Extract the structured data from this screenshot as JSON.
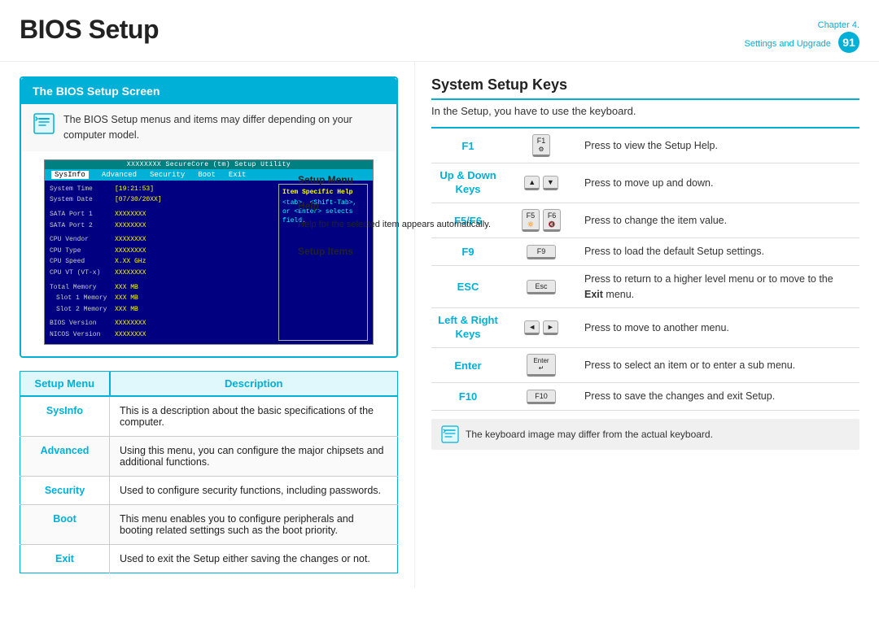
{
  "header": {
    "title": "BIOS Setup",
    "chapter": "Chapter 4.",
    "chapter_sub": "Settings and Upgrade",
    "page_num": "91"
  },
  "left": {
    "section_title": "The BIOS Setup Screen",
    "note_text": "The BIOS Setup menus and items may differ depending on your computer model.",
    "bios_mock": {
      "title_bar": "XXXXXXXX SecureCore (tm) Setup Utility",
      "menu_items": [
        "SysInfo",
        "Advanced",
        "Security",
        "Boot",
        "Exit"
      ],
      "active_menu": "SysInfo",
      "help_title": "Item Specific Help",
      "help_text": "<tab>, <Shift-Tab>, or <Enter> selects field.",
      "items": [
        {
          "label": "System Time",
          "value": "[19:21:53]"
        },
        {
          "label": "System Date",
          "value": "[07/30/20XX]"
        },
        {
          "label": "SATA Port 1",
          "value": "XXXXXXXX"
        },
        {
          "label": "SATA Port 2",
          "value": "XXXXXXXX"
        },
        {
          "label": "CPU Vendor",
          "value": "XXXXXXXX"
        },
        {
          "label": "CPU Type",
          "value": "XXXXXXXX"
        },
        {
          "label": "CPU Speed",
          "value": "X.XX GHz"
        },
        {
          "label": "CPU VT (VT-x)",
          "value": "XXXXXXXX"
        },
        {
          "label": "Total Memory",
          "value": "XXX MB"
        },
        {
          "label": "  Slot 1 Memory",
          "value": "XXX MB"
        },
        {
          "label": "  Slot 2 Memory",
          "value": "XXX MB"
        },
        {
          "label": "BIOS Version",
          "value": "XXXXXXXX"
        },
        {
          "label": "NICOS Version",
          "value": "XXXXXXXX"
        }
      ]
    },
    "labels": {
      "setup_menu": "Setup Menu",
      "help": "Help",
      "help_desc": "Help for the selected item appears automatically.",
      "setup_items": "Setup Items"
    },
    "table": {
      "col1": "Setup Menu",
      "col2": "Description",
      "rows": [
        {
          "menu": "SysInfo",
          "desc": "This is a description about the basic specifications of the computer."
        },
        {
          "menu": "Advanced",
          "desc": "Using this menu, you can configure the major chipsets and additional functions."
        },
        {
          "menu": "Security",
          "desc": "Used to configure security functions, including passwords."
        },
        {
          "menu": "Boot",
          "desc": "This menu enables you to configure peripherals and booting related settings such as the boot priority."
        },
        {
          "menu": "Exit",
          "desc": "Used to exit the Setup either saving the changes or not."
        }
      ]
    }
  },
  "right": {
    "section_title": "System Setup Keys",
    "intro": "In the Setup, you have to use the keyboard.",
    "keys": [
      {
        "key": "F1",
        "icon_label": "F1",
        "desc": "Press to view the Setup Help."
      },
      {
        "key": "Up & Down Keys",
        "icon_label": "↑ ↓",
        "desc": "Press to move up and down."
      },
      {
        "key": "F5/F6",
        "icon_label": "F5 F6",
        "desc": "Press to change the item value."
      },
      {
        "key": "F9",
        "icon_label": "F9",
        "desc": "Press to load the default Setup settings."
      },
      {
        "key": "ESC",
        "icon_label": "Esc",
        "desc": "Press to return to a higher level menu or to move to the <b>Exit</b> menu."
      },
      {
        "key": "Left & Right Keys",
        "icon_label": "← →",
        "desc": "Press to move to another menu."
      },
      {
        "key": "Enter",
        "icon_label": "Enter ↵",
        "desc": "Press to select an item or to enter a sub menu."
      },
      {
        "key": "F10",
        "icon_label": "F10",
        "desc": "Press to save the changes and exit Setup."
      }
    ],
    "bottom_note": "The keyboard image may differ from the actual keyboard."
  }
}
